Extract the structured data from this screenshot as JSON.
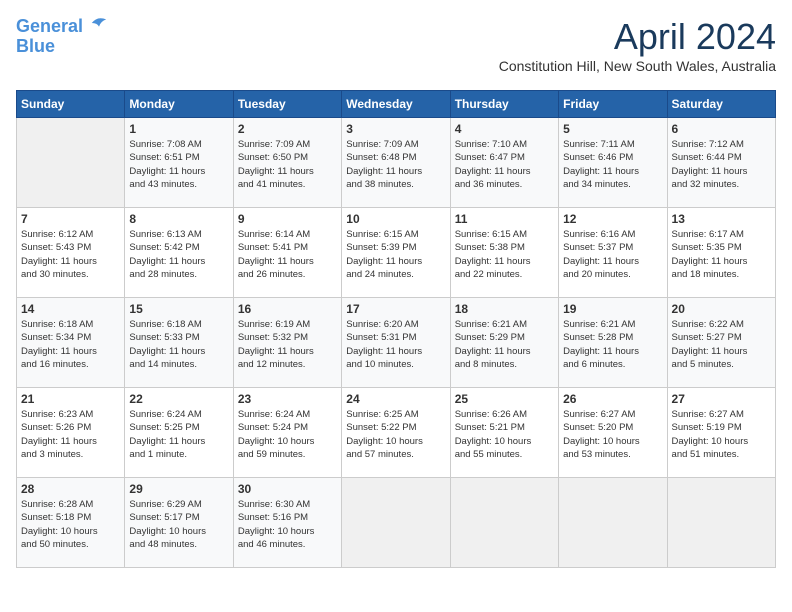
{
  "header": {
    "logo_line1": "General",
    "logo_line2": "Blue",
    "month_title": "April 2024",
    "location": "Constitution Hill, New South Wales, Australia"
  },
  "calendar": {
    "days_of_week": [
      "Sunday",
      "Monday",
      "Tuesday",
      "Wednesday",
      "Thursday",
      "Friday",
      "Saturday"
    ],
    "weeks": [
      [
        {
          "day": "",
          "info": ""
        },
        {
          "day": "1",
          "info": "Sunrise: 7:08 AM\nSunset: 6:51 PM\nDaylight: 11 hours\nand 43 minutes."
        },
        {
          "day": "2",
          "info": "Sunrise: 7:09 AM\nSunset: 6:50 PM\nDaylight: 11 hours\nand 41 minutes."
        },
        {
          "day": "3",
          "info": "Sunrise: 7:09 AM\nSunset: 6:48 PM\nDaylight: 11 hours\nand 38 minutes."
        },
        {
          "day": "4",
          "info": "Sunrise: 7:10 AM\nSunset: 6:47 PM\nDaylight: 11 hours\nand 36 minutes."
        },
        {
          "day": "5",
          "info": "Sunrise: 7:11 AM\nSunset: 6:46 PM\nDaylight: 11 hours\nand 34 minutes."
        },
        {
          "day": "6",
          "info": "Sunrise: 7:12 AM\nSunset: 6:44 PM\nDaylight: 11 hours\nand 32 minutes."
        }
      ],
      [
        {
          "day": "7",
          "info": "Sunrise: 6:12 AM\nSunset: 5:43 PM\nDaylight: 11 hours\nand 30 minutes."
        },
        {
          "day": "8",
          "info": "Sunrise: 6:13 AM\nSunset: 5:42 PM\nDaylight: 11 hours\nand 28 minutes."
        },
        {
          "day": "9",
          "info": "Sunrise: 6:14 AM\nSunset: 5:41 PM\nDaylight: 11 hours\nand 26 minutes."
        },
        {
          "day": "10",
          "info": "Sunrise: 6:15 AM\nSunset: 5:39 PM\nDaylight: 11 hours\nand 24 minutes."
        },
        {
          "day": "11",
          "info": "Sunrise: 6:15 AM\nSunset: 5:38 PM\nDaylight: 11 hours\nand 22 minutes."
        },
        {
          "day": "12",
          "info": "Sunrise: 6:16 AM\nSunset: 5:37 PM\nDaylight: 11 hours\nand 20 minutes."
        },
        {
          "day": "13",
          "info": "Sunrise: 6:17 AM\nSunset: 5:35 PM\nDaylight: 11 hours\nand 18 minutes."
        }
      ],
      [
        {
          "day": "14",
          "info": "Sunrise: 6:18 AM\nSunset: 5:34 PM\nDaylight: 11 hours\nand 16 minutes."
        },
        {
          "day": "15",
          "info": "Sunrise: 6:18 AM\nSunset: 5:33 PM\nDaylight: 11 hours\nand 14 minutes."
        },
        {
          "day": "16",
          "info": "Sunrise: 6:19 AM\nSunset: 5:32 PM\nDaylight: 11 hours\nand 12 minutes."
        },
        {
          "day": "17",
          "info": "Sunrise: 6:20 AM\nSunset: 5:31 PM\nDaylight: 11 hours\nand 10 minutes."
        },
        {
          "day": "18",
          "info": "Sunrise: 6:21 AM\nSunset: 5:29 PM\nDaylight: 11 hours\nand 8 minutes."
        },
        {
          "day": "19",
          "info": "Sunrise: 6:21 AM\nSunset: 5:28 PM\nDaylight: 11 hours\nand 6 minutes."
        },
        {
          "day": "20",
          "info": "Sunrise: 6:22 AM\nSunset: 5:27 PM\nDaylight: 11 hours\nand 5 minutes."
        }
      ],
      [
        {
          "day": "21",
          "info": "Sunrise: 6:23 AM\nSunset: 5:26 PM\nDaylight: 11 hours\nand 3 minutes."
        },
        {
          "day": "22",
          "info": "Sunrise: 6:24 AM\nSunset: 5:25 PM\nDaylight: 11 hours\nand 1 minute."
        },
        {
          "day": "23",
          "info": "Sunrise: 6:24 AM\nSunset: 5:24 PM\nDaylight: 10 hours\nand 59 minutes."
        },
        {
          "day": "24",
          "info": "Sunrise: 6:25 AM\nSunset: 5:22 PM\nDaylight: 10 hours\nand 57 minutes."
        },
        {
          "day": "25",
          "info": "Sunrise: 6:26 AM\nSunset: 5:21 PM\nDaylight: 10 hours\nand 55 minutes."
        },
        {
          "day": "26",
          "info": "Sunrise: 6:27 AM\nSunset: 5:20 PM\nDaylight: 10 hours\nand 53 minutes."
        },
        {
          "day": "27",
          "info": "Sunrise: 6:27 AM\nSunset: 5:19 PM\nDaylight: 10 hours\nand 51 minutes."
        }
      ],
      [
        {
          "day": "28",
          "info": "Sunrise: 6:28 AM\nSunset: 5:18 PM\nDaylight: 10 hours\nand 50 minutes."
        },
        {
          "day": "29",
          "info": "Sunrise: 6:29 AM\nSunset: 5:17 PM\nDaylight: 10 hours\nand 48 minutes."
        },
        {
          "day": "30",
          "info": "Sunrise: 6:30 AM\nSunset: 5:16 PM\nDaylight: 10 hours\nand 46 minutes."
        },
        {
          "day": "",
          "info": ""
        },
        {
          "day": "",
          "info": ""
        },
        {
          "day": "",
          "info": ""
        },
        {
          "day": "",
          "info": ""
        }
      ]
    ]
  }
}
